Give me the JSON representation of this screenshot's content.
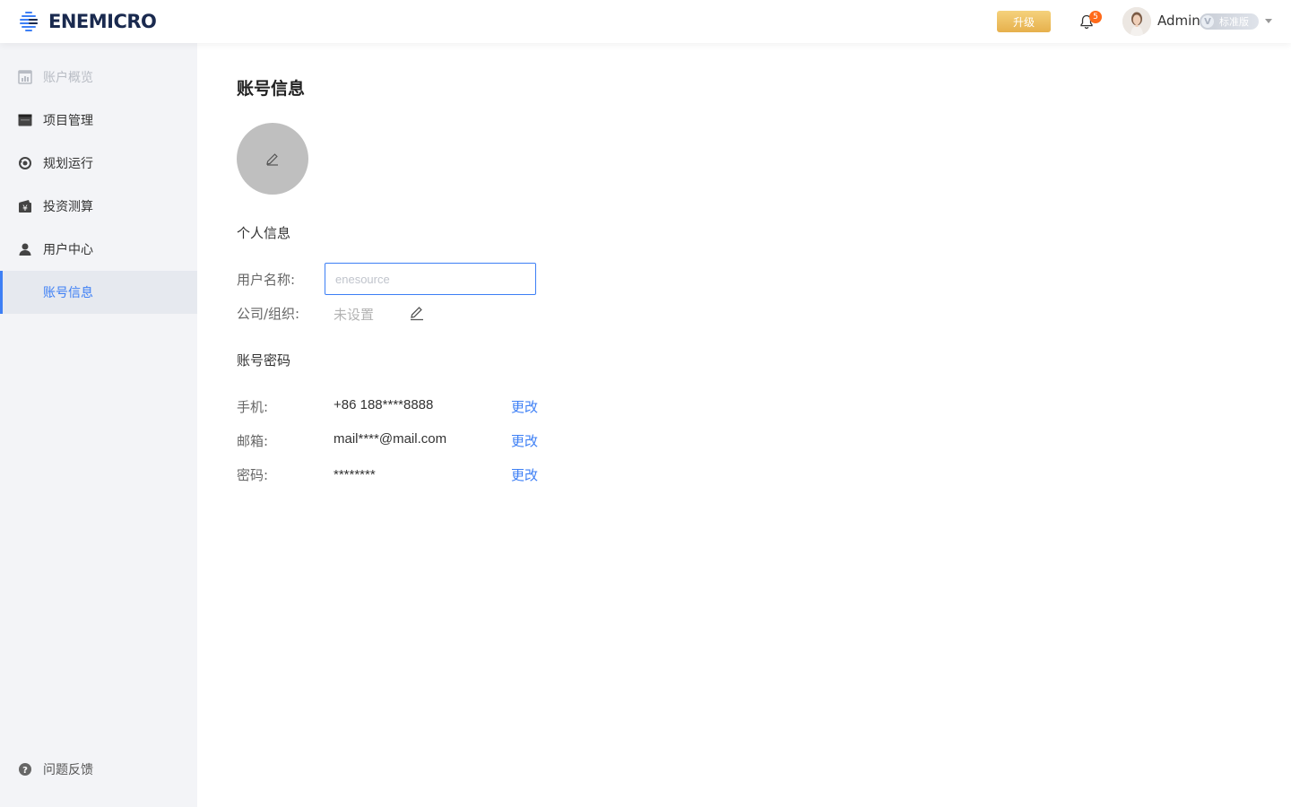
{
  "header": {
    "brand": "ENEMICRO",
    "upgrade_label": "升级",
    "notification_count": "5",
    "user_name": "Admin",
    "plan_label": "标准版",
    "plan_mark": "V"
  },
  "sidebar": {
    "items": [
      {
        "label": "账户概览",
        "icon": "overview-icon",
        "state": "disabled"
      },
      {
        "label": "项目管理",
        "icon": "folder-icon",
        "state": "normal"
      },
      {
        "label": "规划运行",
        "icon": "run-icon",
        "state": "normal"
      },
      {
        "label": "投资测算",
        "icon": "yen-wallet-icon",
        "state": "normal"
      },
      {
        "label": "用户中心",
        "icon": "user-icon",
        "state": "normal"
      },
      {
        "label": "账号信息",
        "icon": "",
        "state": "active"
      }
    ],
    "feedback_label": "问题反馈"
  },
  "main": {
    "title": "账号信息",
    "personal_section": "个人信息",
    "username_label": "用户名称:",
    "username_placeholder": "enesource",
    "company_label": "公司/组织:",
    "company_value": "未设置",
    "password_section": "账号密码",
    "phone_label": "手机:",
    "phone_value": "+86 188****8888",
    "email_label": "邮箱:",
    "email_value": "mail****@mail.com",
    "password_label": "密码:",
    "password_value": "********",
    "change_label": "更改"
  },
  "colors": {
    "accent": "#3d7ff5",
    "sidebar_bg": "#f3f4f7",
    "upgrade_gold": "#e6b04c",
    "badge_orange": "#ff6a1a"
  }
}
